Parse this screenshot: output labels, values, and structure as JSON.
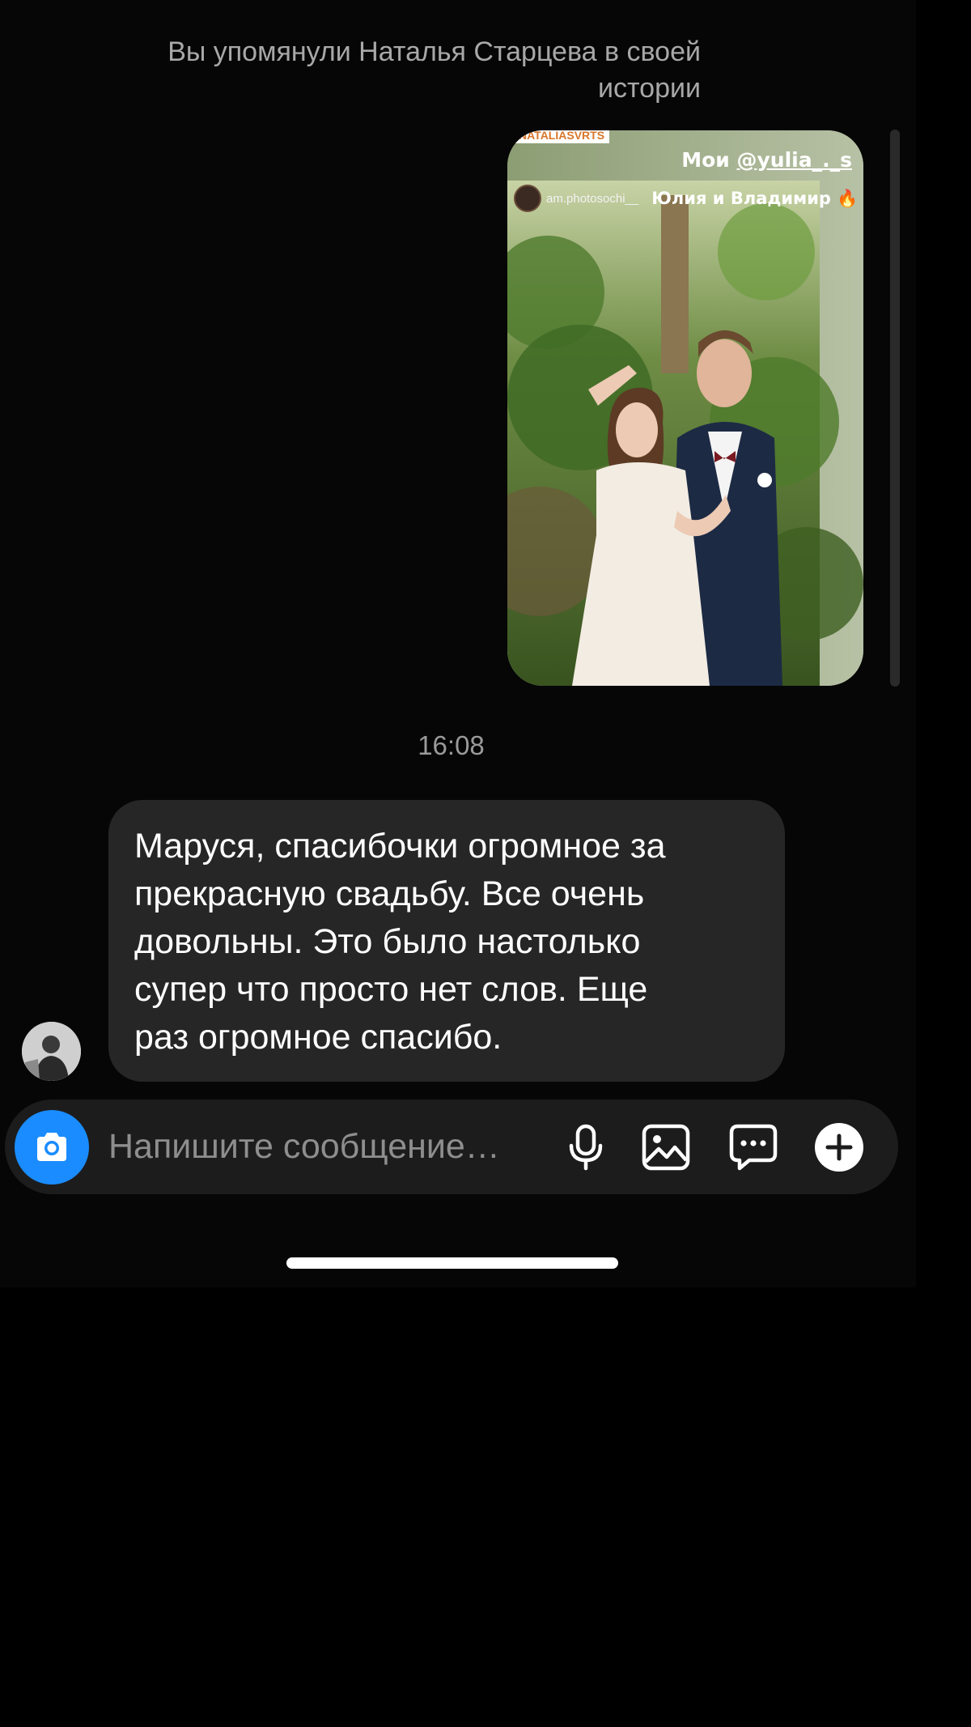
{
  "mention_note": "Вы упомянули Наталья Старцева в своей истории",
  "story": {
    "tag": "NATALIASVRTS",
    "mention_prefix": "Мои",
    "mention_handle": "@yulia_._s",
    "author_user": "am.photosochi__",
    "author_names": "Юлия и Владимир 🔥"
  },
  "timestamp": "16:08",
  "message": {
    "text": "Маруся, спасибочки огромное за\nпрекрасную свадьбу. Все очень\nдовольны. Это было настолько\nсупер что просто нет слов. Еще\nраз огромное спасибо."
  },
  "composer": {
    "placeholder": "Напишите сообщение…",
    "icons": [
      "camera-icon",
      "microphone-icon",
      "gallery-icon",
      "sticker-chat-icon",
      "plus-icon"
    ]
  },
  "colors": {
    "accent": "#1a8cff",
    "bubble": "#262626",
    "background": "#060606"
  }
}
